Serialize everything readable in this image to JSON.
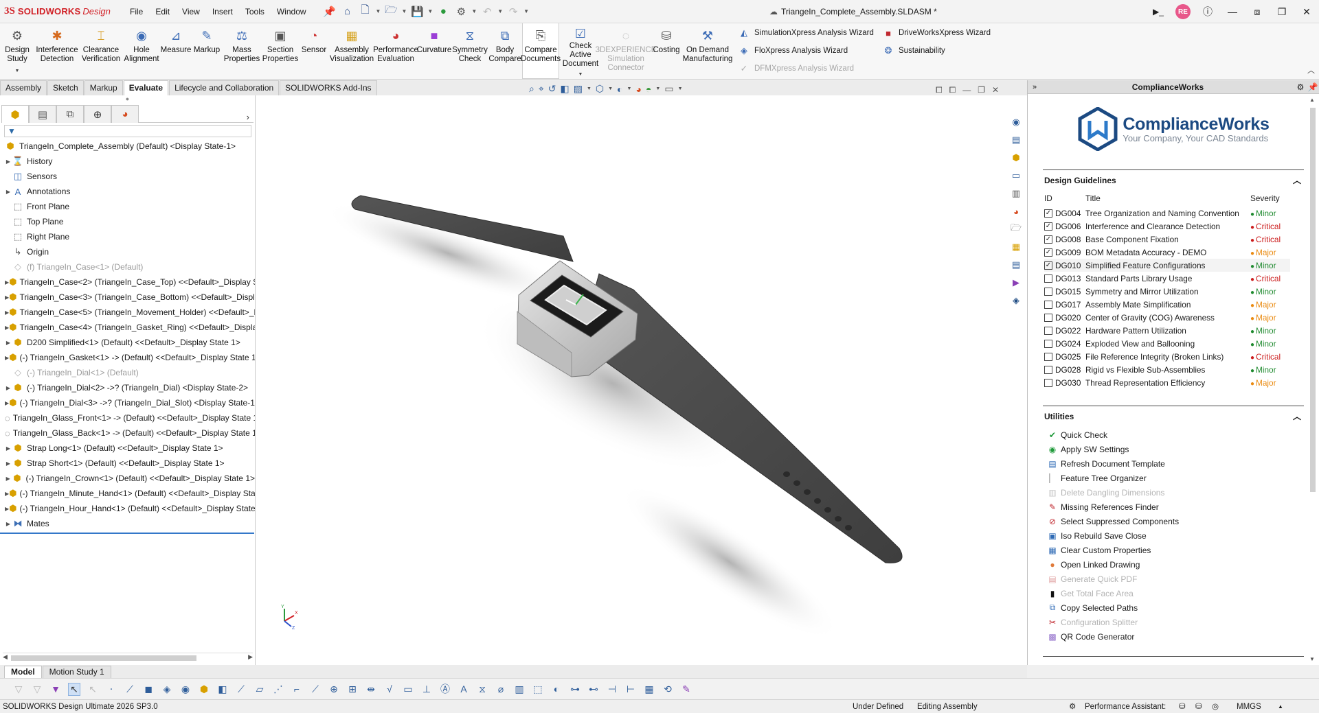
{
  "app": {
    "brand_ds": "3S",
    "brand_sw": "SOLIDWORKS",
    "brand_design": "Design",
    "document_title": "TriangeIn_Complete_Assembly.SLDASM *",
    "user_initials": "RE"
  },
  "menu": [
    "File",
    "Edit",
    "View",
    "Insert",
    "Tools",
    "Window"
  ],
  "ribbon": {
    "buttons": [
      {
        "label": "Design\nStudy",
        "icon": "design-study-icon",
        "glyph": "⚙",
        "color": "#555555"
      },
      {
        "label": "Interference\nDetection",
        "icon": "interference-icon",
        "glyph": "✱",
        "color": "#d66a1e"
      },
      {
        "label": "Clearance\nVerification",
        "icon": "clearance-icon",
        "glyph": "⌶",
        "color": "#d69a1e"
      },
      {
        "label": "Hole\nAlignment",
        "icon": "hole-alignment-icon",
        "glyph": "◉",
        "color": "#3a6ab5"
      },
      {
        "label": "Measure",
        "icon": "measure-icon",
        "glyph": "⊿",
        "color": "#3a6ab5"
      },
      {
        "label": "Markup",
        "icon": "markup-icon",
        "glyph": "✎",
        "color": "#3a6ab5"
      },
      {
        "label": "Mass\nProperties",
        "icon": "mass-properties-icon",
        "glyph": "⚖",
        "color": "#3a6ab5"
      },
      {
        "label": "Section\nProperties",
        "icon": "section-properties-icon",
        "glyph": "▣",
        "color": "#555555"
      },
      {
        "label": "Sensor",
        "icon": "sensor-icon",
        "glyph": "◔",
        "color": "#cc3333"
      },
      {
        "label": "Assembly\nVisualization",
        "icon": "assembly-visualization-icon",
        "glyph": "▦",
        "color": "#d6a21e"
      },
      {
        "label": "Performance\nEvaluation",
        "icon": "performance-evaluation-icon",
        "glyph": "◕",
        "color": "#cc3333"
      },
      {
        "label": "Curvature",
        "icon": "curvature-icon",
        "glyph": "■",
        "color": "#9b3fd6"
      },
      {
        "label": "Symmetry\nCheck",
        "icon": "symmetry-check-icon",
        "glyph": "⧖",
        "color": "#3a6ab5"
      },
      {
        "label": "Body\nCompare",
        "icon": "body-compare-icon",
        "glyph": "⧉",
        "color": "#3a6ab5"
      },
      {
        "label": "Compare\nDocuments",
        "icon": "compare-documents-icon",
        "glyph": "⎘",
        "color": "#555555",
        "active": true
      },
      {
        "label": "Check Active\nDocument",
        "icon": "check-active-document-icon",
        "glyph": "☑",
        "color": "#3a6ab5",
        "caret": true
      },
      {
        "label": "3DEXPERIENCE\nSimulation\nConnector",
        "icon": "3dexperience-icon",
        "glyph": "◌",
        "color": "#b0b0b0",
        "disabled": true
      },
      {
        "label": "Costing",
        "icon": "costing-icon",
        "glyph": "⛁",
        "color": "#555555"
      },
      {
        "label": "On Demand\nManufacturing",
        "icon": "on-demand-manufacturing-icon",
        "glyph": "⚒",
        "color": "#3a6ab5"
      }
    ],
    "wizards_col1": [
      {
        "label": "SimulationXpress Analysis Wizard",
        "icon": "simulationxpress-icon",
        "glyph": "◭",
        "color": "#3a6ab5"
      },
      {
        "label": "FloXpress Analysis Wizard",
        "icon": "floxpress-icon",
        "glyph": "◈",
        "color": "#3a6ab5"
      },
      {
        "label": "DFMXpress Analysis Wizard",
        "icon": "dfmxpress-icon",
        "glyph": "✓",
        "color": "#b0b0b0",
        "disabled": true
      }
    ],
    "wizards_col2": [
      {
        "label": "DriveWorksXpress Wizard",
        "icon": "driveworksxpress-icon",
        "glyph": "■",
        "color": "#c0282f"
      },
      {
        "label": "Sustainability",
        "icon": "sustainability-icon",
        "glyph": "❂",
        "color": "#3a6ab5"
      }
    ]
  },
  "command_tabs": [
    {
      "label": "Assembly"
    },
    {
      "label": "Sketch"
    },
    {
      "label": "Markup"
    },
    {
      "label": "Evaluate",
      "active": true
    },
    {
      "label": "Lifecycle and Collaboration"
    },
    {
      "label": "SOLIDWORKS Add-Ins"
    }
  ],
  "tree": {
    "root": "TriangeIn_Complete_Assembly (Default) <Display State-1>",
    "items": [
      {
        "label": "History",
        "icon": "history-icon",
        "glyph": "⌛",
        "cls": "icon-folder",
        "exp": true
      },
      {
        "label": "Sensors",
        "icon": "sensors-icon",
        "glyph": "◫",
        "cls": "icon-folder",
        "exp": false
      },
      {
        "label": "Annotations",
        "icon": "annotations-icon",
        "glyph": "A",
        "cls": "icon-folder",
        "exp": true
      },
      {
        "label": "Front Plane",
        "icon": "plane-icon",
        "glyph": "⬚",
        "cls": "icon-plane",
        "exp": false
      },
      {
        "label": "Top Plane",
        "icon": "plane-icon",
        "glyph": "⬚",
        "cls": "icon-plane",
        "exp": false
      },
      {
        "label": "Right Plane",
        "icon": "plane-icon",
        "glyph": "⬚",
        "cls": "icon-plane",
        "exp": false
      },
      {
        "label": "Origin",
        "icon": "origin-icon",
        "glyph": "↳",
        "cls": "icon-plane",
        "exp": false
      },
      {
        "label": "(f) TriangeIn_Case<1> (Default)",
        "icon": "part-icon",
        "glyph": "◇",
        "cls": "icon-part",
        "exp": false,
        "grey": true
      },
      {
        "label": "TriangeIn_Case<2> (TriangeIn_Case_Top) <<Default>_Display State 1>",
        "icon": "part-icon",
        "glyph": "⬢",
        "cls": "icon-part",
        "exp": true
      },
      {
        "label": "TriangeIn_Case<3> (TriangeIn_Case_Bottom) <<Default>_Display State 1>",
        "icon": "part-icon",
        "glyph": "⬢",
        "cls": "icon-part",
        "exp": true
      },
      {
        "label": "TriangeIn_Case<5> (TriangeIn_Movement_Holder) <<Default>_Display State 1>",
        "icon": "part-icon",
        "glyph": "⬢",
        "cls": "icon-part",
        "exp": true
      },
      {
        "label": "TriangeIn_Case<4> (TriangeIn_Gasket_Ring) <<Default>_Display State 1>",
        "icon": "part-icon",
        "glyph": "⬢",
        "cls": "icon-part",
        "exp": true
      },
      {
        "label": "D200 Simplified<1> (Default) <<Default>_Display State 1>",
        "icon": "part-icon",
        "glyph": "⬢",
        "cls": "icon-part",
        "exp": true
      },
      {
        "label": "(-) TriangeIn_Gasket<1> -> (Default) <<Default>_Display State 1>",
        "icon": "part-icon",
        "glyph": "⬢",
        "cls": "icon-part",
        "exp": true
      },
      {
        "label": "(-) TriangeIn_Dial<1> (Default)",
        "icon": "part-icon",
        "glyph": "◇",
        "cls": "icon-part",
        "exp": false,
        "grey": true
      },
      {
        "label": "(-) TriangeIn_Dial<2> ->? (TriangeIn_Dial) <Display State-2>",
        "icon": "part-icon",
        "glyph": "⬢",
        "cls": "icon-part",
        "exp": true
      },
      {
        "label": "(-) TriangeIn_Dial<3> ->? (TriangeIn_Dial_Slot) <Display State-1>",
        "icon": "part-icon",
        "glyph": "⬢",
        "cls": "icon-part",
        "exp": true
      },
      {
        "label": "TriangeIn_Glass_Front<1> -> (Default) <<Default>_Display State 1>",
        "icon": "glass-part-icon",
        "glyph": "◌",
        "cls": "icon-plane",
        "exp": false
      },
      {
        "label": "TriangeIn_Glass_Back<1> -> (Default) <<Default>_Display State 1>",
        "icon": "glass-part-icon",
        "glyph": "◌",
        "cls": "icon-plane",
        "exp": false
      },
      {
        "label": "Strap Long<1> (Default) <<Default>_Display State 1>",
        "icon": "part-icon",
        "glyph": "⬢",
        "cls": "icon-part",
        "exp": true
      },
      {
        "label": "Strap Short<1> (Default) <<Default>_Display State 1>",
        "icon": "part-icon",
        "glyph": "⬢",
        "cls": "icon-part",
        "exp": true
      },
      {
        "label": "(-) TriangeIn_Crown<1> (Default) <<Default>_Display State 1>",
        "icon": "part-icon",
        "glyph": "⬢",
        "cls": "icon-part",
        "exp": true
      },
      {
        "label": "(-) TriangeIn_Minute_Hand<1> (Default) <<Default>_Display State 1>",
        "icon": "part-icon",
        "glyph": "⬢",
        "cls": "icon-part",
        "exp": true
      },
      {
        "label": "(-) TriangeIn_Hour_Hand<1> (Default) <<Default>_Display State 1>",
        "icon": "part-icon",
        "glyph": "⬢",
        "cls": "icon-part",
        "exp": true
      },
      {
        "label": "Mates",
        "icon": "mates-icon",
        "glyph": "⧓",
        "cls": "icon-mates",
        "exp": true
      }
    ]
  },
  "compliance": {
    "panel_title": "ComplianceWorks",
    "logo_name": "ComplianceWorks",
    "logo_tagline": "Your Company, Your CAD Standards",
    "guidelines_title": "Design Guidelines",
    "columns": {
      "id": "ID",
      "title": "Title",
      "severity": "Severity"
    },
    "guidelines": [
      {
        "id": "DG004",
        "title": "Tree Organization and Naming Convention",
        "severity": "Minor",
        "checked": true
      },
      {
        "id": "DG006",
        "title": "Interference and Clearance Detection",
        "severity": "Critical",
        "checked": true
      },
      {
        "id": "DG008",
        "title": "Base Component Fixation",
        "severity": "Critical",
        "checked": true
      },
      {
        "id": "DG009",
        "title": "BOM Metadata Accuracy - DEMO",
        "severity": "Major",
        "checked": true
      },
      {
        "id": "DG010",
        "title": "Simplified Feature Configurations",
        "severity": "Minor",
        "checked": true,
        "selected": true
      },
      {
        "id": "DG013",
        "title": "Standard Parts Library Usage",
        "severity": "Critical",
        "checked": false
      },
      {
        "id": "DG015",
        "title": "Symmetry and Mirror Utilization",
        "severity": "Minor",
        "checked": false
      },
      {
        "id": "DG017",
        "title": "Assembly Mate Simplification",
        "severity": "Major",
        "checked": false
      },
      {
        "id": "DG020",
        "title": "Center of Gravity (COG) Awareness",
        "severity": "Major",
        "checked": false
      },
      {
        "id": "DG022",
        "title": "Hardware Pattern Utilization",
        "severity": "Minor",
        "checked": false
      },
      {
        "id": "DG024",
        "title": "Exploded View and Ballooning",
        "severity": "Minor",
        "checked": false
      },
      {
        "id": "DG025",
        "title": "File Reference Integrity (Broken Links)",
        "severity": "Critical",
        "checked": false
      },
      {
        "id": "DG028",
        "title": "Rigid vs Flexible Sub-Assemblies",
        "severity": "Minor",
        "checked": false
      },
      {
        "id": "DG030",
        "title": "Thread Representation Efficiency",
        "severity": "Major",
        "checked": false
      }
    ],
    "utilities_title": "Utilities",
    "utilities": [
      {
        "label": "Quick Check",
        "icon": "check-mark-icon",
        "glyph": "✔",
        "color": "#1f9a3a"
      },
      {
        "label": "Apply SW Settings",
        "icon": "apply-settings-icon",
        "glyph": "◉",
        "color": "#1f9a3a"
      },
      {
        "label": "Refresh Document Template",
        "icon": "refresh-template-icon",
        "glyph": "▤",
        "color": "#2e6ab5"
      },
      {
        "label": "Feature Tree Organizer",
        "icon": "tree-organizer-icon",
        "glyph": "▏",
        "color": "#9b9b9b"
      },
      {
        "label": "Delete Dangling Dimensions",
        "icon": "delete-dimensions-icon",
        "glyph": "▥",
        "color": "#c8c8c8",
        "disabled": true
      },
      {
        "label": "Missing References Finder",
        "icon": "missing-references-icon",
        "glyph": "✎",
        "color": "#c0282f"
      },
      {
        "label": "Select Suppressed Components",
        "icon": "suppressed-components-icon",
        "glyph": "⊘",
        "color": "#c0282f"
      },
      {
        "label": "Iso Rebuild Save Close",
        "icon": "rebuild-save-icon",
        "glyph": "▣",
        "color": "#2e6ab5"
      },
      {
        "label": "Clear Custom Properties",
        "icon": "clear-properties-icon",
        "glyph": "▦",
        "color": "#2e6ab5"
      },
      {
        "label": "Open Linked Drawing",
        "icon": "linked-drawing-icon",
        "glyph": "●",
        "color": "#e07a3a"
      },
      {
        "label": "Generate Quick PDF",
        "icon": "pdf-icon",
        "glyph": "▤",
        "color": "#e0a0a0",
        "disabled": true
      },
      {
        "label": "Get Total Face Area",
        "icon": "face-area-icon",
        "glyph": "▮",
        "color": "#111111",
        "disabled": true
      },
      {
        "label": "Copy Selected Paths",
        "icon": "copy-paths-icon",
        "glyph": "⧉",
        "color": "#2e6ab5"
      },
      {
        "label": "Configuration Splitter",
        "icon": "config-splitter-icon",
        "glyph": "✂",
        "color": "#c0282f",
        "disabled": true
      },
      {
        "label": "QR Code Generator",
        "icon": "qr-code-icon",
        "glyph": "▩",
        "color": "#8f6bc9"
      }
    ]
  },
  "bottom_tabs": [
    {
      "label": "Model",
      "active": true
    },
    {
      "label": "Motion Study 1"
    }
  ],
  "status": {
    "product": "SOLIDWORKS Design Ultimate 2026 SP3.0",
    "definition": "Under Defined",
    "mode": "Editing Assembly",
    "performance": "Performance Assistant:",
    "units": "MMGS"
  },
  "triad": {
    "x": "X",
    "y": "Y",
    "z": "Z"
  }
}
